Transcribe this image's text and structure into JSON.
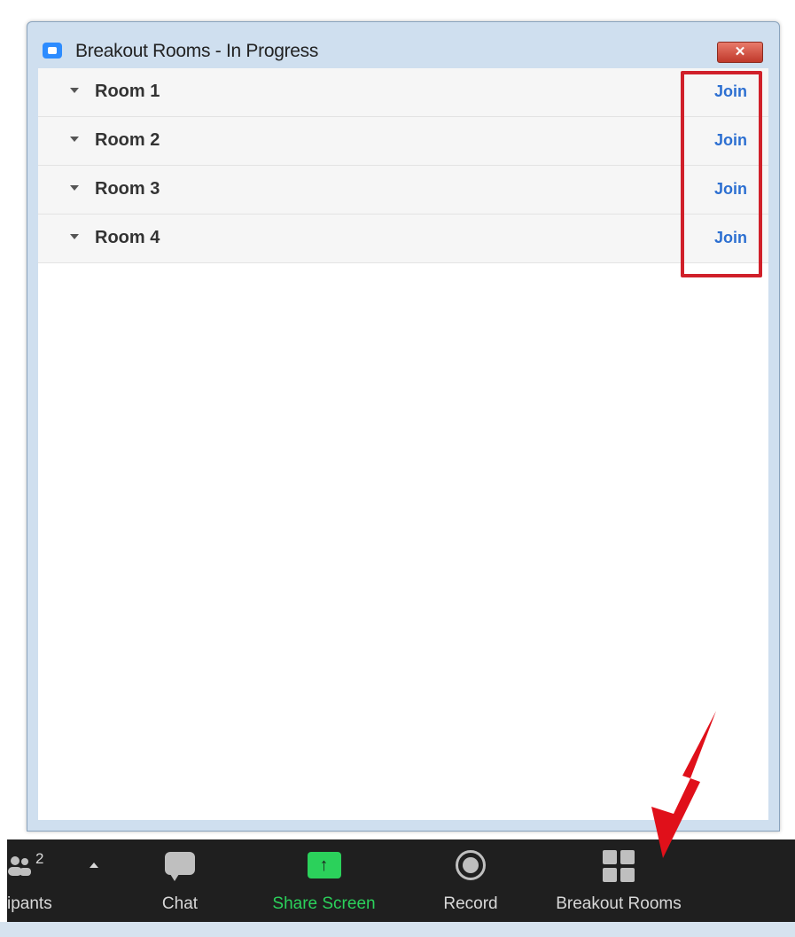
{
  "window": {
    "title": "Breakout Rooms - In Progress",
    "close_glyph": "✕"
  },
  "rooms": [
    {
      "label": "Room 1",
      "join_label": "Join"
    },
    {
      "label": "Room 2",
      "join_label": "Join"
    },
    {
      "label": "Room 3",
      "join_label": "Join"
    },
    {
      "label": "Room 4",
      "join_label": "Join"
    }
  ],
  "toolbar": {
    "participants_label": "ipants",
    "participants_count": "2",
    "chat_label": "Chat",
    "share_screen_label": "Share Screen",
    "share_screen_glyph": "↑",
    "record_label": "Record",
    "breakout_rooms_label": "Breakout Rooms"
  },
  "colors": {
    "highlight": "#d0202a",
    "join_link": "#2c6fd1",
    "share_screen_accent": "#2bd15b",
    "toolbar_bg": "#1f1f1f"
  },
  "icons": [
    "zoom-app-icon",
    "close-icon",
    "caret-down-icon",
    "participants-icon",
    "caret-up-icon",
    "chat-icon",
    "share-screen-icon",
    "record-icon",
    "breakout-rooms-icon",
    "red-arrow-annotation"
  ]
}
